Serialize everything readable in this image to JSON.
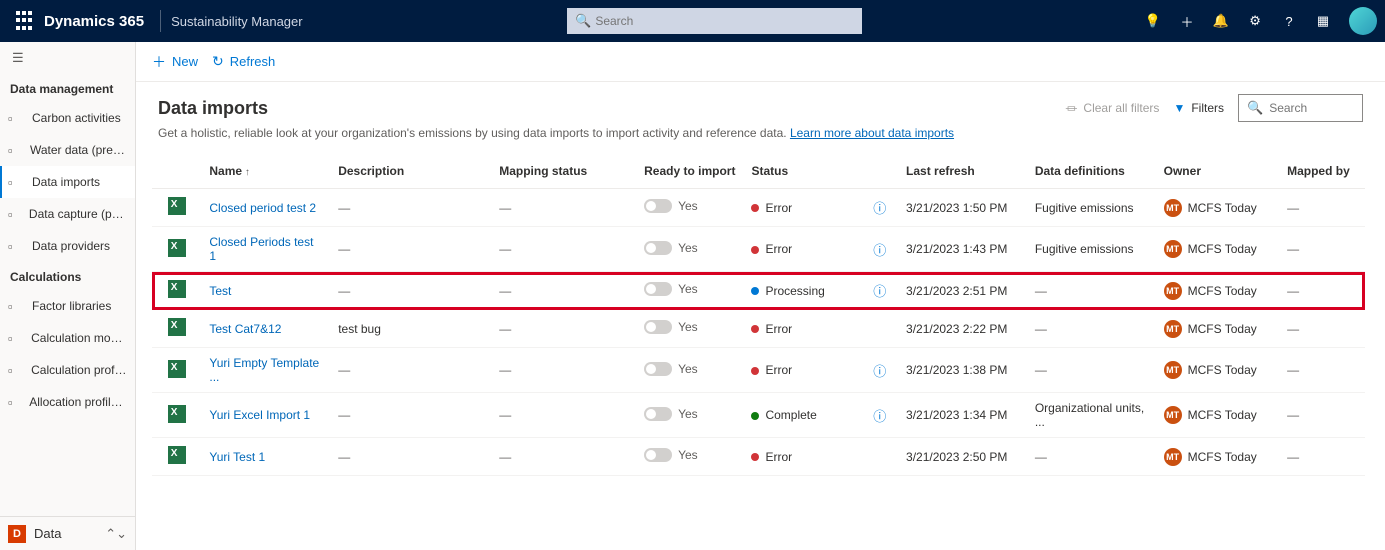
{
  "topbar": {
    "brand": "Dynamics 365",
    "app": "Sustainability Manager",
    "search_placeholder": "Search"
  },
  "sidebar": {
    "sections": [
      {
        "title": "Data management",
        "items": [
          {
            "icon": "cloud-icon",
            "label": "Carbon activities"
          },
          {
            "icon": "water-icon",
            "label": "Water data (preview)"
          },
          {
            "icon": "import-icon",
            "label": "Data imports",
            "active": true
          },
          {
            "icon": "capture-icon",
            "label": "Data capture (preview)"
          },
          {
            "icon": "provider-icon",
            "label": "Data providers"
          }
        ]
      },
      {
        "title": "Calculations",
        "items": [
          {
            "icon": "library-icon",
            "label": "Factor libraries"
          },
          {
            "icon": "model-icon",
            "label": "Calculation models"
          },
          {
            "icon": "profile-icon",
            "label": "Calculation profiles"
          },
          {
            "icon": "alloc-icon",
            "label": "Allocation profiles (p..."
          }
        ]
      }
    ],
    "footer": {
      "badge": "D",
      "label": "Data"
    }
  },
  "cmdbar": {
    "new": "New",
    "refresh": "Refresh"
  },
  "page": {
    "title": "Data imports",
    "subtitle_pre": "Get a holistic, reliable look at your organization's emissions by using data imports to import activity and reference data. ",
    "subtitle_link": "Learn more about data imports",
    "clear_filters": "Clear all filters",
    "filters": "Filters",
    "search_placeholder": "Search"
  },
  "table": {
    "cols": {
      "name": "Name",
      "desc": "Description",
      "mapping": "Mapping status",
      "ready": "Ready to import",
      "status": "Status",
      "refresh": "Last refresh",
      "defs": "Data definitions",
      "owner": "Owner",
      "mapped": "Mapped by"
    },
    "toggle_label": "Yes",
    "owner_initials": "MT",
    "rows": [
      {
        "name": "Closed period test 2",
        "desc": "—",
        "mapping": "—",
        "status": "Error",
        "status_dot": "dot-error",
        "info": true,
        "refresh": "3/21/2023 1:50 PM",
        "defs": "Fugitive emissions",
        "owner": "MCFS Today",
        "mapped": "—"
      },
      {
        "name": "Closed Periods test 1",
        "desc": "—",
        "mapping": "—",
        "status": "Error",
        "status_dot": "dot-error",
        "info": true,
        "refresh": "3/21/2023 1:43 PM",
        "defs": "Fugitive emissions",
        "owner": "MCFS Today",
        "mapped": "—"
      },
      {
        "name": "Test",
        "desc": "—",
        "mapping": "—",
        "status": "Processing",
        "status_dot": "dot-processing",
        "info": true,
        "refresh": "3/21/2023 2:51 PM",
        "defs": "—",
        "owner": "MCFS Today",
        "mapped": "—",
        "highlight": true
      },
      {
        "name": "Test Cat7&12",
        "desc": "test bug",
        "mapping": "—",
        "status": "Error",
        "status_dot": "dot-error",
        "info": false,
        "refresh": "3/21/2023 2:22 PM",
        "defs": "—",
        "owner": "MCFS Today",
        "mapped": "—"
      },
      {
        "name": "Yuri Empty Template ...",
        "desc": "—",
        "mapping": "—",
        "status": "Error",
        "status_dot": "dot-error",
        "info": true,
        "refresh": "3/21/2023 1:38 PM",
        "defs": "—",
        "owner": "MCFS Today",
        "mapped": "—"
      },
      {
        "name": "Yuri Excel Import 1",
        "desc": "—",
        "mapping": "—",
        "status": "Complete",
        "status_dot": "dot-complete",
        "info": true,
        "refresh": "3/21/2023 1:34 PM",
        "defs": "Organizational units, ...",
        "owner": "MCFS Today",
        "mapped": "—"
      },
      {
        "name": "Yuri Test 1",
        "desc": "—",
        "mapping": "—",
        "status": "Error",
        "status_dot": "dot-error",
        "info": false,
        "refresh": "3/21/2023 2:50 PM",
        "defs": "—",
        "owner": "MCFS Today",
        "mapped": "—"
      }
    ]
  }
}
